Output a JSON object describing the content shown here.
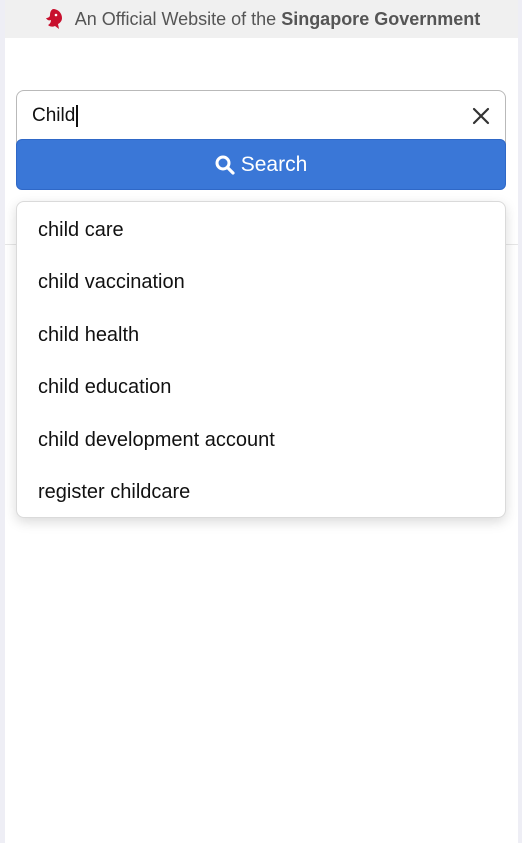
{
  "masthead": {
    "prefix": "An Official Website of the",
    "bold": "Singapore Government",
    "logo_icon": "lion-head-icon",
    "logo_color": "#c8102e"
  },
  "search": {
    "value": "Child",
    "clear_icon": "close-icon",
    "button_label": "Search",
    "button_icon": "search-icon",
    "button_color": "#3a77d7"
  },
  "suggestions": [
    "child care",
    "child vaccination",
    "child health",
    "child education",
    "child development account",
    "register childcare"
  ]
}
